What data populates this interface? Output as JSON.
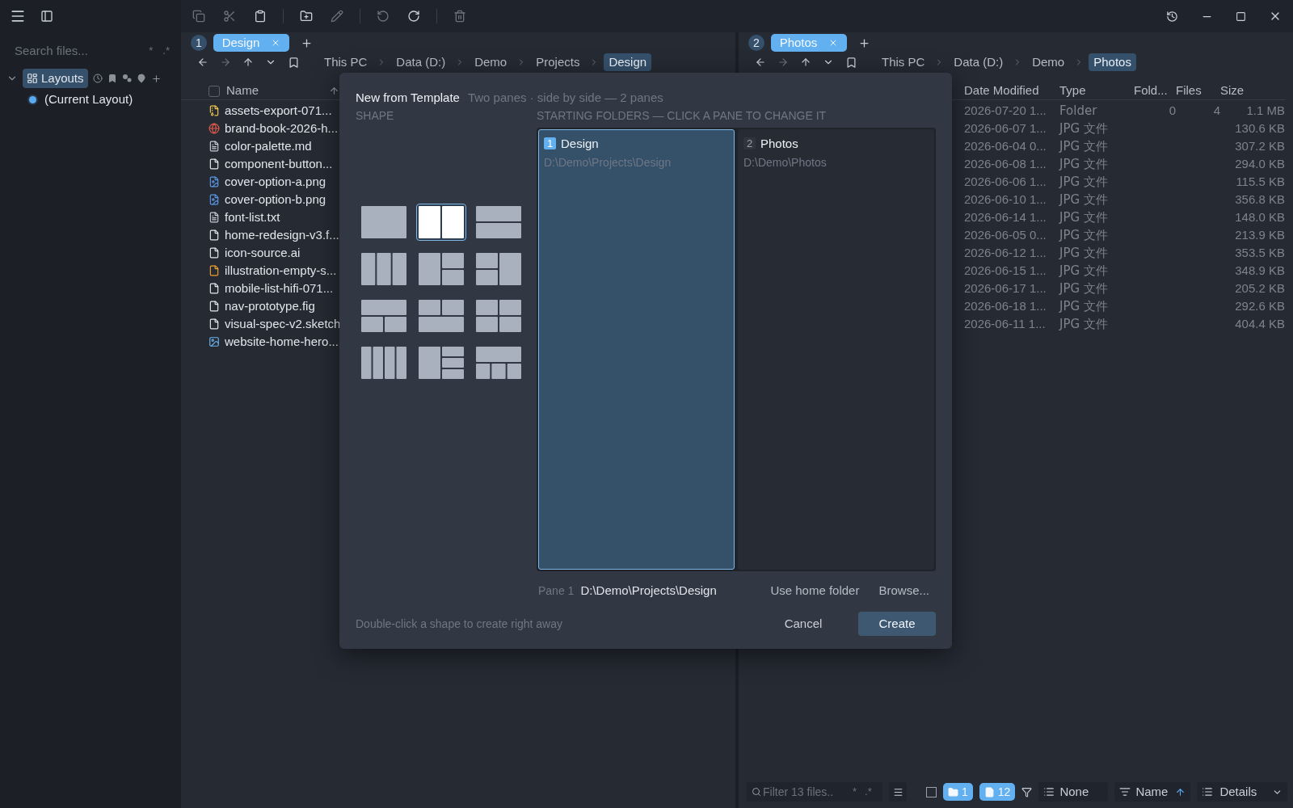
{
  "toolbar": [
    {
      "kind": "copy",
      "disabled": true
    },
    {
      "kind": "cut",
      "disabled": true
    },
    {
      "kind": "paste",
      "disabled": false
    },
    {
      "kind": "separator"
    },
    {
      "kind": "new-folder",
      "disabled": false
    },
    {
      "kind": "rename",
      "disabled": true
    },
    {
      "kind": "separator"
    },
    {
      "kind": "undo",
      "disabled": true
    },
    {
      "kind": "redo",
      "disabled": false
    },
    {
      "kind": "separator"
    },
    {
      "kind": "delete",
      "disabled": true
    }
  ],
  "sidebar": {
    "search": {
      "placeholder": "Search files...",
      "toggles": [
        "*",
        ".*"
      ]
    },
    "tree": [
      {
        "label": "Layouts",
        "expanded": true,
        "selected": true,
        "children": [
          {
            "label": "(Current Layout)",
            "checked": true
          }
        ]
      }
    ]
  },
  "panes": [
    {
      "number": "1",
      "tabs": [
        {
          "label": "Design",
          "selected": true
        }
      ],
      "breadcrumb": [
        {
          "label": "This PC",
          "selected": false
        },
        {
          "label": "Data (D:)",
          "selected": false
        },
        {
          "label": "Demo",
          "selected": false
        },
        {
          "label": "Projects",
          "selected": false
        },
        {
          "label": "Design",
          "selected": true
        }
      ],
      "columns": [
        {
          "label": "Name",
          "checked": false,
          "ascending": true
        }
      ],
      "rows": [
        {
          "name": "assets-export-071...",
          "kind": "archive"
        },
        {
          "name": "brand-book-2026-h...",
          "kind": "web"
        },
        {
          "name": "color-palette.md",
          "kind": "markdown"
        },
        {
          "name": "component-button...",
          "kind": "generic"
        },
        {
          "name": "cover-option-a.png",
          "kind": "image"
        },
        {
          "name": "cover-option-b.png",
          "kind": "image"
        },
        {
          "name": "font-list.txt",
          "kind": "text"
        },
        {
          "name": "home-redesign-v3.f...",
          "kind": "generic"
        },
        {
          "name": "icon-source.ai",
          "kind": "generic"
        },
        {
          "name": "illustration-empty-s...",
          "kind": "script"
        },
        {
          "name": "mobile-list-hifi-071...",
          "kind": "generic"
        },
        {
          "name": "nav-prototype.fig",
          "kind": "generic"
        },
        {
          "name": "visual-spec-v2.sketch",
          "kind": "generic"
        },
        {
          "name": "website-home-hero...",
          "kind": "photo"
        }
      ]
    },
    {
      "number": "2",
      "tabs": [
        {
          "label": "Photos",
          "selected": true
        }
      ],
      "breadcrumb": [
        {
          "label": "This PC",
          "selected": false
        },
        {
          "label": "Data (D:)",
          "selected": false
        },
        {
          "label": "Demo",
          "selected": false
        },
        {
          "label": "Photos",
          "selected": true
        }
      ],
      "columns": [
        {
          "label": "Date Modified"
        },
        {
          "label": "Type"
        },
        {
          "label": "Fold..."
        },
        {
          "label": "Files"
        },
        {
          "label": "Size"
        }
      ],
      "rows": [
        {
          "date": "2026-07-20 1...",
          "type": "Folder",
          "folders": "0",
          "files": "4",
          "size": "1.1 MB"
        },
        {
          "date": "2026-06-07 1...",
          "type": "JPG 文件",
          "size": "130.6 KB"
        },
        {
          "date": "2026-06-04 0...",
          "type": "JPG 文件",
          "size": "307.2 KB"
        },
        {
          "date": "2026-06-08 1...",
          "type": "JPG 文件",
          "size": "294.0 KB"
        },
        {
          "date": "2026-06-06 1...",
          "type": "JPG 文件",
          "size": "115.5 KB"
        },
        {
          "date": "2026-06-10 1...",
          "type": "JPG 文件",
          "size": "356.8 KB"
        },
        {
          "date": "2026-06-14 1...",
          "type": "JPG 文件",
          "size": "148.0 KB"
        },
        {
          "date": "2026-06-05 0...",
          "type": "JPG 文件",
          "size": "213.9 KB"
        },
        {
          "date": "2026-06-12 1...",
          "type": "JPG 文件",
          "size": "353.5 KB"
        },
        {
          "date": "2026-06-15 1...",
          "type": "JPG 文件",
          "size": "348.9 KB"
        },
        {
          "date": "2026-06-17 1...",
          "type": "JPG 文件",
          "size": "205.2 KB"
        },
        {
          "date": "2026-06-18 1...",
          "type": "JPG 文件",
          "size": "292.6 KB"
        },
        {
          "date": "2026-06-11 1...",
          "type": "JPG 文件",
          "size": "404.4 KB"
        }
      ],
      "status_bar": {
        "filter": {
          "placeholder": "Filter 13 files..",
          "toggles": [
            "*",
            ".*"
          ]
        },
        "select_all": {
          "checked": false
        },
        "counts": [
          {
            "kind": "folders",
            "label": "1",
            "on": true
          },
          {
            "kind": "files",
            "label": "12",
            "on": true
          }
        ],
        "group": "None",
        "sort": {
          "label": "Name",
          "ascending": true
        },
        "view": "Details"
      }
    }
  ],
  "dialog": {
    "title": "New from Template",
    "subtitle": "Two panes · side by side — 2 panes",
    "shape_label": "SHAPE",
    "folders_label": "STARTING FOLDERS — CLICK A PANE TO CHANGE IT",
    "shapes": [
      {
        "kind": "single",
        "selected": false
      },
      {
        "kind": "cols-2",
        "selected": true
      },
      {
        "kind": "rows-2",
        "selected": false
      },
      {
        "kind": "cols-3",
        "selected": false
      },
      {
        "kind": "left-right2",
        "selected": false
      },
      {
        "kind": "left2-right",
        "selected": false
      },
      {
        "kind": "top-bottom2",
        "selected": false
      },
      {
        "kind": "top2-bottom",
        "selected": false
      },
      {
        "kind": "grid-4",
        "selected": false
      },
      {
        "kind": "cols-4",
        "selected": false
      },
      {
        "kind": "left-right3",
        "selected": false
      },
      {
        "kind": "top-bottom3",
        "selected": false
      }
    ],
    "panes": [
      {
        "number": "1",
        "name": "Design",
        "path": "D:\\Demo\\Projects\\Design",
        "selected": true
      },
      {
        "number": "2",
        "name": "Photos",
        "path": "D:\\Demo\\Photos",
        "selected": false
      }
    ],
    "current": {
      "label": "Pane 1",
      "path": "D:\\Demo\\Projects\\Design"
    },
    "actions": [
      "Use home folder",
      "Browse..."
    ],
    "hint": "Double-click a shape to create right away",
    "buttons": [
      {
        "label": "Cancel",
        "kind": "secondary"
      },
      {
        "label": "Create",
        "kind": "primary"
      }
    ]
  }
}
